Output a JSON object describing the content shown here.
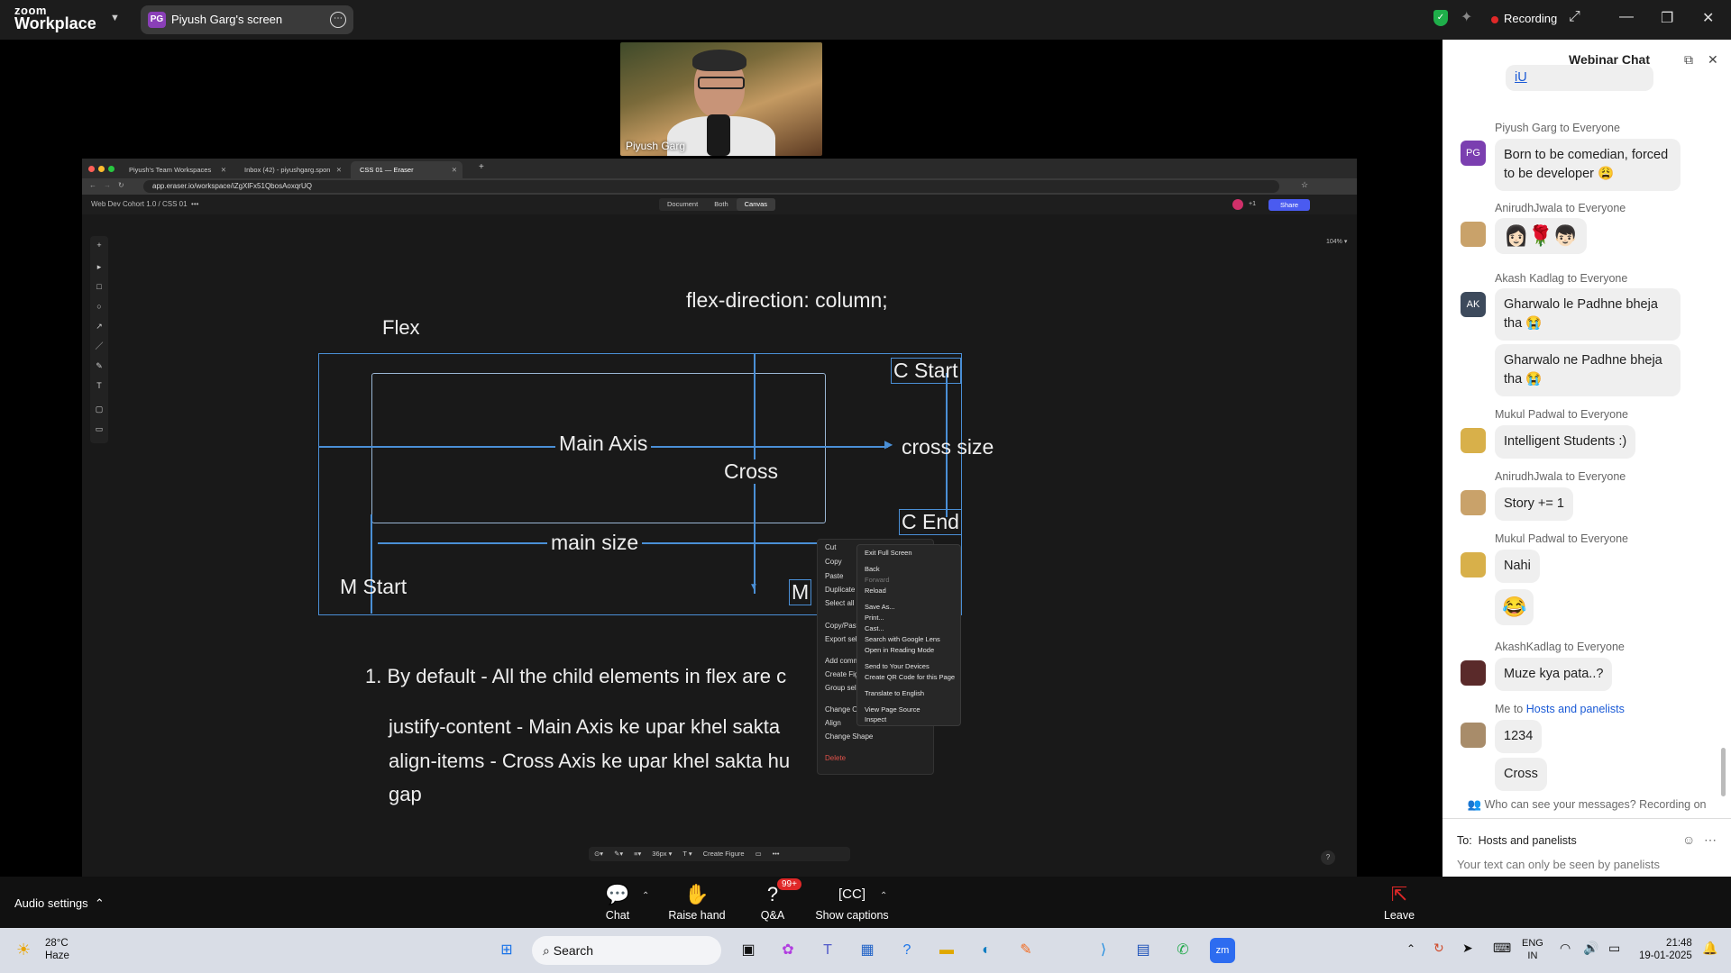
{
  "zoom": {
    "logo_line1": "zoom",
    "logo_line2": "Workplace",
    "share_initials": "PG",
    "share_label": "Piyush Garg's screen",
    "recording_label": "Recording"
  },
  "video": {
    "presenter_name": "Piyush Garg"
  },
  "browser": {
    "tabs": [
      {
        "label": "Piyush's Team Workspaces"
      },
      {
        "label": "Inbox (42) - piyushgarg.spon"
      },
      {
        "label": "CSS 01 — Eraser"
      }
    ],
    "new_tab": "+",
    "url": "app.eraser.io/workspace/iZgXlFx51QbosAoxqrUQ",
    "breadcrumb": "Web Dev Cohort 1.0  /  CSS 01",
    "breadcrumb_more": "•••",
    "view_modes": [
      "Document",
      "Both",
      "Canvas"
    ],
    "collab_count": "+1",
    "share_label": "Share",
    "zoom_level": "104% ▾",
    "bottom_toolbar": [
      "36px ▾",
      "T ▾",
      "Create Figure"
    ],
    "help": "?"
  },
  "diagram": {
    "title_code": "flex-direction: column;",
    "flex_label": "Flex",
    "c_start": "C Start",
    "main_axis": "Main Axis",
    "cross_size": "cross size",
    "cross": "Cross",
    "c_end": "C End",
    "main_size": "main size",
    "m_start": "M Start",
    "m_end_partial": "M",
    "note_1": "1. By default - All the child elements in flex are c",
    "note_justify": "justify-content - Main Axis ke upar khel sakta",
    "note_align": "align-items - Cross Axis ke upar khel sakta hu",
    "note_gap": "gap"
  },
  "context_menu_primary": [
    "Cut",
    "Copy",
    "Paste",
    "Duplicate",
    "Select all",
    "Copy/Paste",
    "Export sele",
    "Add comm",
    "Create Figu",
    "Group sele",
    "Change Or",
    "Align",
    "Change Shape",
    "Delete"
  ],
  "context_menu_browser": [
    "Exit Full Screen",
    "Back",
    "Forward",
    "Reload",
    "Save As...",
    "Print...",
    "Cast...",
    "Search with Google Lens",
    "Open in Reading Mode",
    "Send to Your Devices",
    "Create QR Code for this Page",
    "Translate to English",
    "View Page Source",
    "Inspect"
  ],
  "chat": {
    "title": "Webinar Chat",
    "top_link": "iU",
    "messages": [
      {
        "sender": "Piyush Garg to Everyone",
        "initials": "PG",
        "avatar_color": "#7b3fb0",
        "texts": [
          "Born to be comedian, forced to be developer 😩"
        ]
      },
      {
        "sender": "AnirudhJwala to Everyone",
        "initials": "",
        "avatar_color": "#c9a26a",
        "texts": [
          "👩🏻🌹👦🏻"
        ]
      },
      {
        "sender": "Akash Kadlag to Everyone",
        "initials": "AK",
        "avatar_color": "#3d4a5c",
        "texts": [
          "Gharwalo le Padhne bheja tha 😭",
          "Gharwalo ne Padhne bheja tha 😭"
        ]
      },
      {
        "sender": "Mukul Padwal to Everyone",
        "initials": "",
        "avatar_color": "#d8b04a",
        "texts": [
          "Intelligent Students :)"
        ]
      },
      {
        "sender": "AnirudhJwala to Everyone",
        "initials": "",
        "avatar_color": "#c9a26a",
        "texts": [
          "Story += 1"
        ]
      },
      {
        "sender": "Mukul Padwal to Everyone",
        "initials": "",
        "avatar_color": "#d8b04a",
        "texts": [
          "Nahi",
          "😂"
        ]
      },
      {
        "sender": "AkashKadlag to Everyone",
        "initials": "",
        "avatar_color": "#5a2a2a",
        "texts": [
          "Muze kya pata..?"
        ]
      },
      {
        "sender_prefix": "Me to ",
        "sender_target": "Hosts and panelists",
        "initials": "",
        "avatar_color": "#a88c6a",
        "texts": [
          "1234",
          "Cross"
        ]
      }
    ],
    "notice": "Who can see your messages? Recording on",
    "to_label": "To:",
    "to_value": "Hosts and panelists",
    "input_placeholder": "Your text can only be seen by panelists"
  },
  "controls": {
    "audio_settings": "Audio settings",
    "chat": "Chat",
    "raise_hand": "Raise hand",
    "qa": "Q&A",
    "qa_badge": "99+",
    "captions": "Show captions",
    "leave": "Leave"
  },
  "taskbar": {
    "temp": "28°C",
    "weather": "Haze",
    "search": "Search",
    "lang1": "ENG",
    "lang2": "IN",
    "time": "21:48",
    "date": "19-01-2025"
  },
  "colors": {
    "accent_blue": "#4a5bf0",
    "selection": "#4a8fd6",
    "record_red": "#e02828",
    "link_blue": "#1a5ad6"
  }
}
